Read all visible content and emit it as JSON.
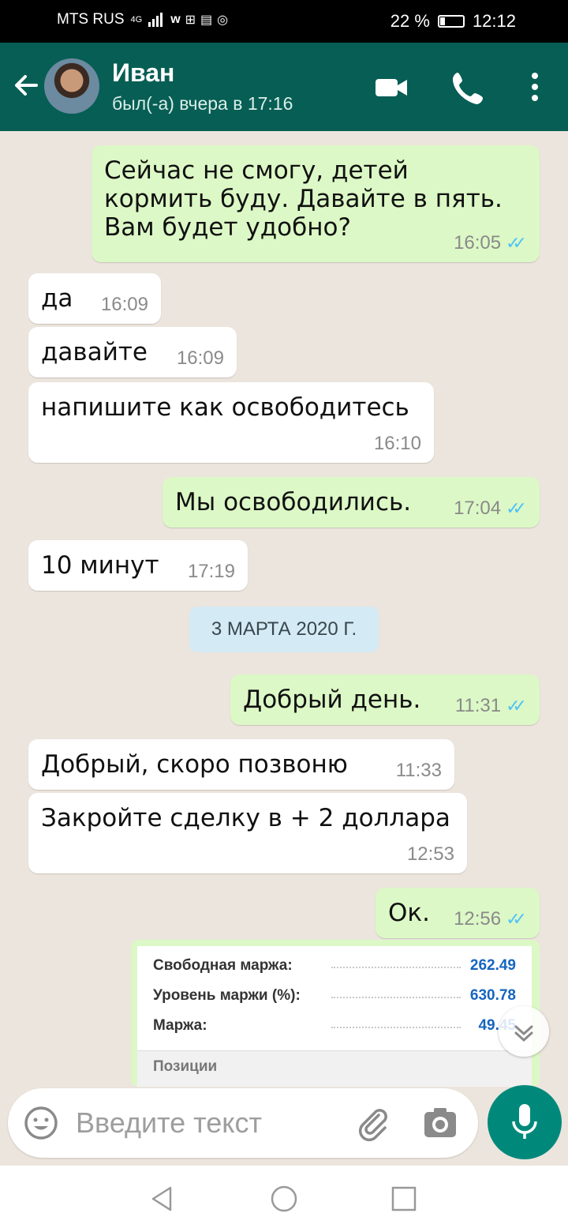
{
  "status_bar": {
    "carrier": "MTS RUS",
    "network": "4G",
    "battery": "22 %",
    "battery_level": 0.22,
    "time": "12:12"
  },
  "header": {
    "contact_name": "Иван",
    "last_seen": "был(-а) вчера в 17:16",
    "icons": [
      "back-arrow-icon",
      "video-call-icon",
      "voice-call-icon",
      "more-vert-icon"
    ]
  },
  "messages": [
    {
      "dir": "out",
      "text": "Сейчас не смогу, детей кормить буду. Давайте в пять. Вам будет удобно?",
      "time": "16:05",
      "read": true
    },
    {
      "dir": "in",
      "text": "да",
      "time": "16:09"
    },
    {
      "dir": "in",
      "text": "давайте",
      "time": "16:09"
    },
    {
      "dir": "in",
      "text": "напишите как освободитесь",
      "time": "16:10"
    },
    {
      "dir": "out",
      "text": "Мы освободились.",
      "time": "17:04",
      "read": true
    },
    {
      "dir": "in",
      "text": "10 минут",
      "time": "17:19"
    },
    {
      "dir": "out",
      "text": "Добрый день.",
      "time": "11:31",
      "read": true
    },
    {
      "dir": "in",
      "text": "Добрый, скоро позвоню",
      "time": "11:33"
    },
    {
      "dir": "in",
      "text": "Закройте сделку в + 2 доллара",
      "time": "12:53"
    },
    {
      "dir": "out",
      "text": "Ок.",
      "time": "12:56",
      "read": true
    }
  ],
  "date_divider": "3 МАРТА 2020 Г.",
  "image_message": {
    "rows": [
      {
        "label": "Свободная маржа:",
        "value": "262.49"
      },
      {
        "label": "Уровень маржи (%):",
        "value": "630.78"
      },
      {
        "label": "Маржа:",
        "value": "49.45"
      }
    ],
    "section": "Позиции"
  },
  "input": {
    "placeholder": "Введите текст"
  },
  "colors": {
    "header": "#075e54",
    "outgoing": "#dcf8c6",
    "incoming": "#ffffff",
    "accent": "#00897b",
    "read_ticks": "#4fc3f7"
  }
}
